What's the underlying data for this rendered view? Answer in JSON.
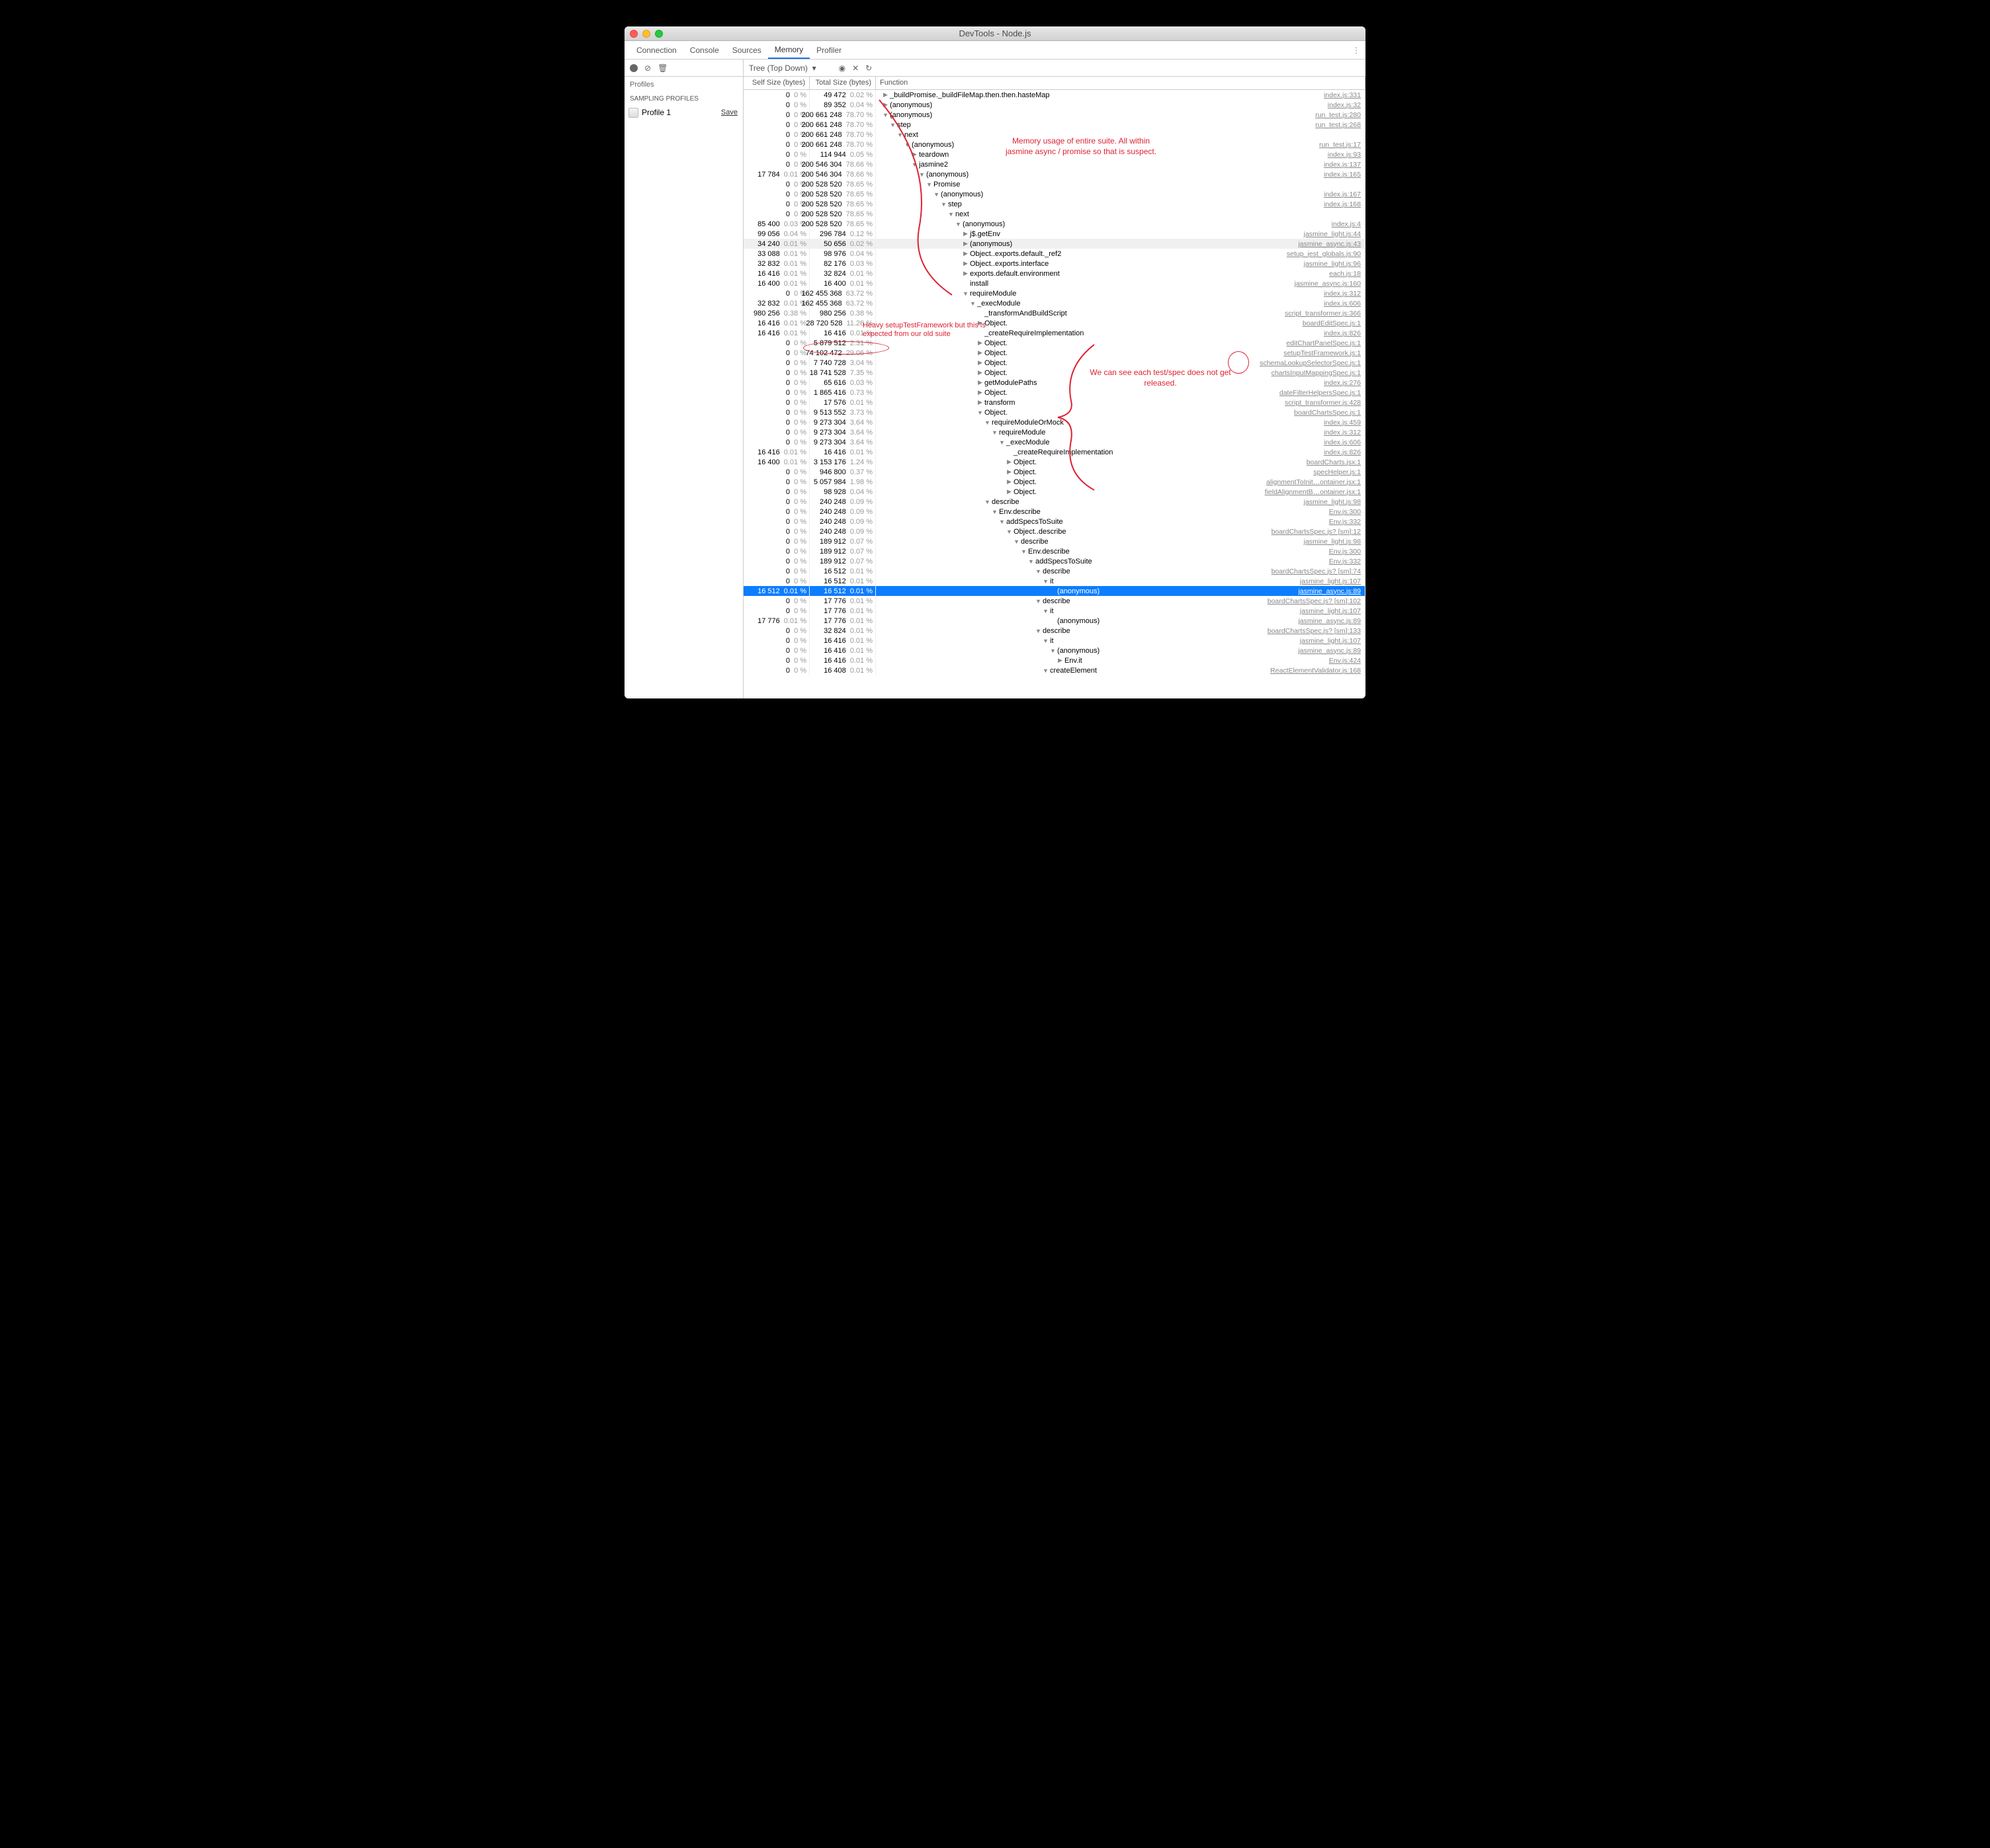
{
  "window_title": "DevTools - Node.js",
  "tabs": [
    "Connection",
    "Console",
    "Sources",
    "Memory",
    "Profiler"
  ],
  "active_tab": "Memory",
  "toolbar_dropdown": "Tree (Top Down)",
  "sidebar": {
    "heading": "Profiles",
    "section": "SAMPLING PROFILES",
    "profile_name": "Profile 1",
    "save_label": "Save"
  },
  "columns": {
    "self": "Self Size (bytes)",
    "total": "Total Size (bytes)",
    "func": "Function"
  },
  "annotations": {
    "a1": "Memory usage of entire suite. All within jasmine async / promise so that is suspect.",
    "a2": "Heavy setupTestFramework but this is expected from our old suite",
    "a3": "We can see each test/spec does not get released."
  },
  "rows": [
    {
      "self": "0",
      "selfPct": "0 %",
      "total": "49 472",
      "totalPct": "0.02 %",
      "indent": 0,
      "tri": "▶",
      "name": "_buildPromise._buildFileMap.then.then.hasteMap",
      "link": "index.js:331"
    },
    {
      "self": "0",
      "selfPct": "0 %",
      "total": "89 352",
      "totalPct": "0.04 %",
      "indent": 0,
      "tri": "▶",
      "name": "(anonymous)",
      "link": "index.js:32"
    },
    {
      "self": "0",
      "selfPct": "0 %",
      "total": "200 661 248",
      "totalPct": "78.70 %",
      "indent": 0,
      "tri": "▼",
      "name": "(anonymous)",
      "link": "run_test.js:280"
    },
    {
      "self": "0",
      "selfPct": "0 %",
      "total": "200 661 248",
      "totalPct": "78.70 %",
      "indent": 1,
      "tri": "▼",
      "name": "step",
      "link": "run_test.js:268"
    },
    {
      "self": "0",
      "selfPct": "0 %",
      "total": "200 661 248",
      "totalPct": "78.70 %",
      "indent": 2,
      "tri": "▼",
      "name": "next",
      "link": ""
    },
    {
      "self": "0",
      "selfPct": "0 %",
      "total": "200 661 248",
      "totalPct": "78.70 %",
      "indent": 3,
      "tri": "▼",
      "name": "(anonymous)",
      "link": "run_test.js:17"
    },
    {
      "self": "0",
      "selfPct": "0 %",
      "total": "114 944",
      "totalPct": "0.05 %",
      "indent": 4,
      "tri": "▶",
      "name": "teardown",
      "link": "index.js:93"
    },
    {
      "self": "0",
      "selfPct": "0 %",
      "total": "200 546 304",
      "totalPct": "78.66 %",
      "indent": 4,
      "tri": "▼",
      "name": "jasmine2",
      "link": "index.js:137"
    },
    {
      "self": "17 784",
      "selfPct": "0.01 %",
      "total": "200 546 304",
      "totalPct": "78.66 %",
      "indent": 5,
      "tri": "▼",
      "name": "(anonymous)",
      "link": "index.js:165"
    },
    {
      "self": "0",
      "selfPct": "0 %",
      "total": "200 528 520",
      "totalPct": "78.65 %",
      "indent": 6,
      "tri": "▼",
      "name": "Promise",
      "link": ""
    },
    {
      "self": "0",
      "selfPct": "0 %",
      "total": "200 528 520",
      "totalPct": "78.65 %",
      "indent": 7,
      "tri": "▼",
      "name": "(anonymous)",
      "link": "index.js:167"
    },
    {
      "self": "0",
      "selfPct": "0 %",
      "total": "200 528 520",
      "totalPct": "78.65 %",
      "indent": 8,
      "tri": "▼",
      "name": "step",
      "link": "index.js:168"
    },
    {
      "self": "0",
      "selfPct": "0 %",
      "total": "200 528 520",
      "totalPct": "78.65 %",
      "indent": 9,
      "tri": "▼",
      "name": "next",
      "link": ""
    },
    {
      "self": "85 400",
      "selfPct": "0.03 %",
      "total": "200 528 520",
      "totalPct": "78.65 %",
      "indent": 10,
      "tri": "▼",
      "name": "(anonymous)",
      "link": "index.js:4"
    },
    {
      "self": "99 056",
      "selfPct": "0.04 %",
      "total": "296 784",
      "totalPct": "0.12 %",
      "indent": 11,
      "tri": "▶",
      "name": "j$.getEnv",
      "link": "jasmine_light.js:44"
    },
    {
      "self": "34 240",
      "selfPct": "0.01 %",
      "total": "50 656",
      "totalPct": "0.02 %",
      "indent": 11,
      "tri": "▶",
      "name": "(anonymous)",
      "link": "jasmine_async.js:43",
      "cls": "greyed"
    },
    {
      "self": "33 088",
      "selfPct": "0.01 %",
      "total": "98 976",
      "totalPct": "0.04 %",
      "indent": 11,
      "tri": "▶",
      "name": "Object.<anonymous>.exports.default._ref2",
      "link": "setup_jest_globals.js:90"
    },
    {
      "self": "32 832",
      "selfPct": "0.01 %",
      "total": "82 176",
      "totalPct": "0.03 %",
      "indent": 11,
      "tri": "▶",
      "name": "Object.<anonymous>.exports.interface",
      "link": "jasmine_light.js:96"
    },
    {
      "self": "16 416",
      "selfPct": "0.01 %",
      "total": "32 824",
      "totalPct": "0.01 %",
      "indent": 11,
      "tri": "▶",
      "name": "exports.default.environment",
      "link": "each.js:18"
    },
    {
      "self": "16 400",
      "selfPct": "0.01 %",
      "total": "16 400",
      "totalPct": "0.01 %",
      "indent": 11,
      "tri": "",
      "name": "install",
      "link": "jasmine_async.js:160"
    },
    {
      "self": "0",
      "selfPct": "0 %",
      "total": "162 455 368",
      "totalPct": "63.72 %",
      "indent": 11,
      "tri": "▼",
      "name": "requireModule",
      "link": "index.js:312"
    },
    {
      "self": "32 832",
      "selfPct": "0.01 %",
      "total": "162 455 368",
      "totalPct": "63.72 %",
      "indent": 12,
      "tri": "▼",
      "name": "_execModule",
      "link": "index.js:606"
    },
    {
      "self": "980 256",
      "selfPct": "0.38 %",
      "total": "980 256",
      "totalPct": "0.38 %",
      "indent": 13,
      "tri": "",
      "name": "_transformAndBuildScript",
      "link": "script_transformer.js:366"
    },
    {
      "self": "16 416",
      "selfPct": "0.01 %",
      "total": "28 720 528",
      "totalPct": "11.26 %",
      "indent": 13,
      "tri": "▶",
      "name": "Object.<anonymous>",
      "link": "boardEditSpec.js:1"
    },
    {
      "self": "16 416",
      "selfPct": "0.01 %",
      "total": "16 416",
      "totalPct": "0.01 %",
      "indent": 13,
      "tri": "",
      "name": "_createRequireImplementation",
      "link": "index.js:826"
    },
    {
      "self": "0",
      "selfPct": "0 %",
      "total": "5 879 512",
      "totalPct": "2.31 %",
      "indent": 13,
      "tri": "▶",
      "name": "Object.<anonymous>",
      "link": "editChartPanelSpec.js:1"
    },
    {
      "self": "0",
      "selfPct": "0 %",
      "total": "74 102 472",
      "totalPct": "29.06 %",
      "indent": 13,
      "tri": "▶",
      "name": "Object.<anonymous>",
      "link": "setupTestFramework.js:1"
    },
    {
      "self": "0",
      "selfPct": "0 %",
      "total": "7 740 728",
      "totalPct": "3.04 %",
      "indent": 13,
      "tri": "▶",
      "name": "Object.<anonymous>",
      "link": "schemaLookupSelectorSpec.js:1"
    },
    {
      "self": "0",
      "selfPct": "0 %",
      "total": "18 741 528",
      "totalPct": "7.35 %",
      "indent": 13,
      "tri": "▶",
      "name": "Object.<anonymous>",
      "link": "chartsInputMappingSpec.js:1"
    },
    {
      "self": "0",
      "selfPct": "0 %",
      "total": "65 616",
      "totalPct": "0.03 %",
      "indent": 13,
      "tri": "▶",
      "name": "getModulePaths",
      "link": "index.js:276"
    },
    {
      "self": "0",
      "selfPct": "0 %",
      "total": "1 865 416",
      "totalPct": "0.73 %",
      "indent": 13,
      "tri": "▶",
      "name": "Object.<anonymous>",
      "link": "dateFilterHelpersSpec.js:1"
    },
    {
      "self": "0",
      "selfPct": "0 %",
      "total": "17 576",
      "totalPct": "0.01 %",
      "indent": 13,
      "tri": "▶",
      "name": "transform",
      "link": "script_transformer.js:428"
    },
    {
      "self": "0",
      "selfPct": "0 %",
      "total": "9 513 552",
      "totalPct": "3.73 %",
      "indent": 13,
      "tri": "▼",
      "name": "Object.<anonymous>",
      "link": "boardChartsSpec.js:1"
    },
    {
      "self": "0",
      "selfPct": "0 %",
      "total": "9 273 304",
      "totalPct": "3.64 %",
      "indent": 14,
      "tri": "▼",
      "name": "requireModuleOrMock",
      "link": "index.js:459"
    },
    {
      "self": "0",
      "selfPct": "0 %",
      "total": "9 273 304",
      "totalPct": "3.64 %",
      "indent": 15,
      "tri": "▼",
      "name": "requireModule",
      "link": "index.js:312"
    },
    {
      "self": "0",
      "selfPct": "0 %",
      "total": "9 273 304",
      "totalPct": "3.64 %",
      "indent": 16,
      "tri": "▼",
      "name": "_execModule",
      "link": "index.js:606"
    },
    {
      "self": "16 416",
      "selfPct": "0.01 %",
      "total": "16 416",
      "totalPct": "0.01 %",
      "indent": 17,
      "tri": "",
      "name": "_createRequireImplementation",
      "link": "index.js:826"
    },
    {
      "self": "16 400",
      "selfPct": "0.01 %",
      "total": "3 153 176",
      "totalPct": "1.24 %",
      "indent": 17,
      "tri": "▶",
      "name": "Object.<anonymous>",
      "link": "boardCharts.jsx:1"
    },
    {
      "self": "0",
      "selfPct": "0 %",
      "total": "946 800",
      "totalPct": "0.37 %",
      "indent": 17,
      "tri": "▶",
      "name": "Object.<anonymous>",
      "link": "specHelper.js:1"
    },
    {
      "self": "0",
      "selfPct": "0 %",
      "total": "5 057 984",
      "totalPct": "1.98 %",
      "indent": 17,
      "tri": "▶",
      "name": "Object.<anonymous>",
      "link": "alignmentToInit…ontainer.jsx:1"
    },
    {
      "self": "0",
      "selfPct": "0 %",
      "total": "98 928",
      "totalPct": "0.04 %",
      "indent": 17,
      "tri": "▶",
      "name": "Object.<anonymous>",
      "link": "fieldAlignmentB…ontainer.jsx:1"
    },
    {
      "self": "0",
      "selfPct": "0 %",
      "total": "240 248",
      "totalPct": "0.09 %",
      "indent": 14,
      "tri": "▼",
      "name": "describe",
      "link": "jasmine_light.js:98"
    },
    {
      "self": "0",
      "selfPct": "0 %",
      "total": "240 248",
      "totalPct": "0.09 %",
      "indent": 15,
      "tri": "▼",
      "name": "Env.describe",
      "link": "Env.js:300"
    },
    {
      "self": "0",
      "selfPct": "0 %",
      "total": "240 248",
      "totalPct": "0.09 %",
      "indent": 16,
      "tri": "▼",
      "name": "addSpecsToSuite",
      "link": "Env.js:332"
    },
    {
      "self": "0",
      "selfPct": "0 %",
      "total": "240 248",
      "totalPct": "0.09 %",
      "indent": 17,
      "tri": "▼",
      "name": "Object.<anonymous>.describe",
      "link": "boardChartsSpec.js? [sm]:12"
    },
    {
      "self": "0",
      "selfPct": "0 %",
      "total": "189 912",
      "totalPct": "0.07 %",
      "indent": 18,
      "tri": "▼",
      "name": "describe",
      "link": "jasmine_light.js:98"
    },
    {
      "self": "0",
      "selfPct": "0 %",
      "total": "189 912",
      "totalPct": "0.07 %",
      "indent": 19,
      "tri": "▼",
      "name": "Env.describe",
      "link": "Env.js:300"
    },
    {
      "self": "0",
      "selfPct": "0 %",
      "total": "189 912",
      "totalPct": "0.07 %",
      "indent": 20,
      "tri": "▼",
      "name": "addSpecsToSuite",
      "link": "Env.js:332"
    },
    {
      "self": "0",
      "selfPct": "0 %",
      "total": "16 512",
      "totalPct": "0.01 %",
      "indent": 21,
      "tri": "▼",
      "name": "describe",
      "link": "boardChartsSpec.js? [sm]:74"
    },
    {
      "self": "0",
      "selfPct": "0 %",
      "total": "16 512",
      "totalPct": "0.01 %",
      "indent": 22,
      "tri": "▼",
      "name": "it",
      "link": "jasmine_light.js:107"
    },
    {
      "self": "16 512",
      "selfPct": "0.01 %",
      "total": "16 512",
      "totalPct": "0.01 %",
      "indent": 23,
      "tri": "",
      "name": "(anonymous)",
      "link": "jasmine_async.js:89",
      "cls": "selected"
    },
    {
      "self": "0",
      "selfPct": "0 %",
      "total": "17 776",
      "totalPct": "0.01 %",
      "indent": 21,
      "tri": "▼",
      "name": "describe",
      "link": "boardChartsSpec.js? [sm]:102"
    },
    {
      "self": "0",
      "selfPct": "0 %",
      "total": "17 776",
      "totalPct": "0.01 %",
      "indent": 22,
      "tri": "▼",
      "name": "it",
      "link": "jasmine_light.js:107"
    },
    {
      "self": "17 776",
      "selfPct": "0.01 %",
      "total": "17 776",
      "totalPct": "0.01 %",
      "indent": 23,
      "tri": "",
      "name": "(anonymous)",
      "link": "jasmine_async.js:89"
    },
    {
      "self": "0",
      "selfPct": "0 %",
      "total": "32 824",
      "totalPct": "0.01 %",
      "indent": 21,
      "tri": "▼",
      "name": "describe",
      "link": "boardChartsSpec.js? [sm]:133"
    },
    {
      "self": "0",
      "selfPct": "0 %",
      "total": "16 416",
      "totalPct": "0.01 %",
      "indent": 22,
      "tri": "▼",
      "name": "it",
      "link": "jasmine_light.js:107"
    },
    {
      "self": "0",
      "selfPct": "0 %",
      "total": "16 416",
      "totalPct": "0.01 %",
      "indent": 23,
      "tri": "▼",
      "name": "(anonymous)",
      "link": "jasmine_async.js:89"
    },
    {
      "self": "0",
      "selfPct": "0 %",
      "total": "16 416",
      "totalPct": "0.01 %",
      "indent": 24,
      "tri": "▶",
      "name": "Env.it",
      "link": "Env.js:424"
    },
    {
      "self": "0",
      "selfPct": "0 %",
      "total": "16 408",
      "totalPct": "0.01 %",
      "indent": 22,
      "tri": "▼",
      "name": "createElement",
      "link": "ReactElementValidator.js:168"
    }
  ]
}
